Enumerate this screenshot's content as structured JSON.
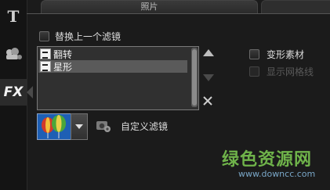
{
  "tabs": {
    "active_label": "照片"
  },
  "left_toolbar": {
    "fx_label": "FX"
  },
  "filter_panel": {
    "replace_checkbox_label": "替换上一个滤镜",
    "replace_checked": false,
    "list_items": [
      {
        "label": "翻转",
        "selected": false
      },
      {
        "label": "星形",
        "selected": true
      }
    ],
    "custom_filter_label": "自定义滤镜"
  },
  "right_options": {
    "deform_label": "变形素材",
    "deform_checked": false,
    "grid_label": "显示网格线",
    "grid_enabled": false
  },
  "watermark": {
    "brand": "绿色资源网",
    "url": "www.downcc.com"
  },
  "colors": {
    "background": "#1b1b1b",
    "selection": "#5a5a5a",
    "watermark_green": "#6fb34a"
  }
}
